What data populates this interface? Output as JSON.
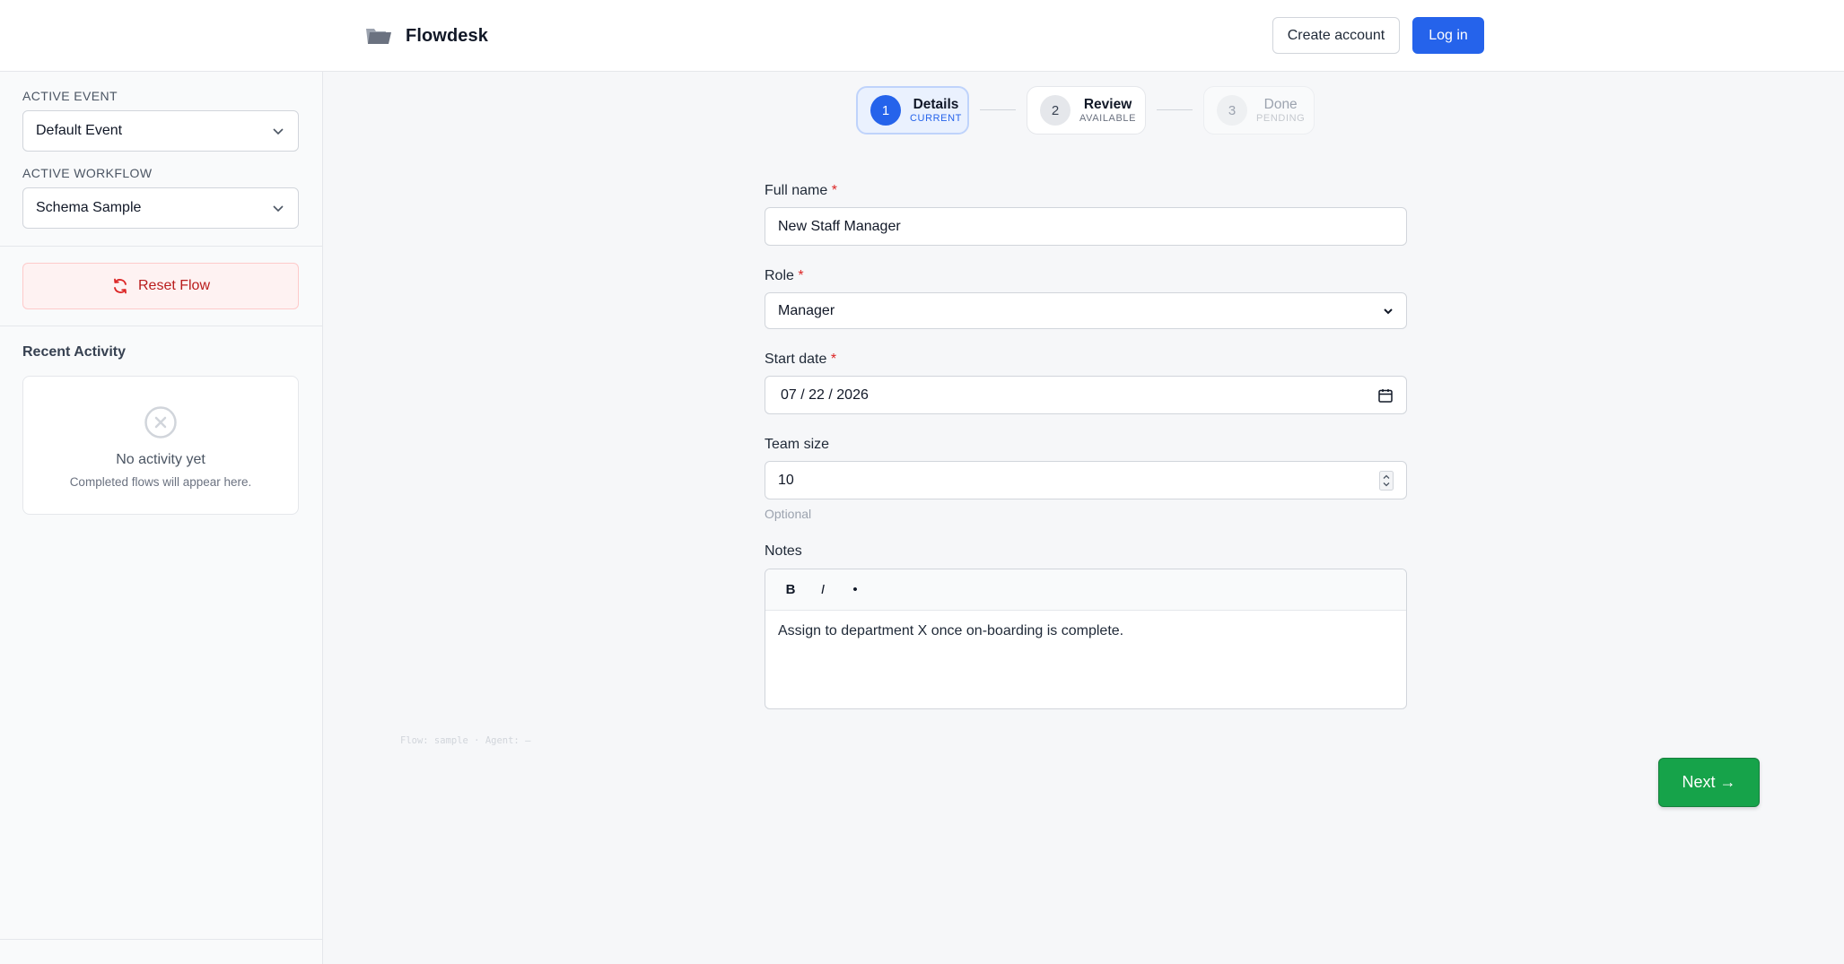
{
  "header": {
    "brand_name": "Flowdesk",
    "create_account_label": "Create account",
    "login_label": "Log in"
  },
  "sidebar": {
    "active_event_label": "ACTIVE EVENT",
    "active_event_value": "Default Event",
    "active_workflow_label": "ACTIVE WORKFLOW",
    "active_workflow_value": "Schema Sample",
    "reset_label": "Reset Flow",
    "recent_title": "Recent Activity",
    "empty_title": "No activity yet",
    "empty_subtitle": "Completed flows will appear here."
  },
  "stepper": {
    "steps": [
      {
        "number": "1",
        "title": "Details",
        "status": "CURRENT"
      },
      {
        "number": "2",
        "title": "Review",
        "status": "AVAILABLE"
      },
      {
        "number": "3",
        "title": "Done",
        "status": "PENDING"
      }
    ]
  },
  "form": {
    "full_name": {
      "label": "Full name",
      "required": "*",
      "value": "New Staff Manager"
    },
    "role": {
      "label": "Role",
      "required": "*",
      "value": "Manager"
    },
    "start_date": {
      "label": "Start date",
      "required": "*",
      "value": "07 / 22 / 2026"
    },
    "team_size": {
      "label": "Team size",
      "value": "10",
      "help": "Optional"
    },
    "notes": {
      "label": "Notes",
      "toolbar": {
        "bold": "B",
        "italic": "I",
        "bullet": "•"
      },
      "value": "Assign to department X once on-boarding is complete."
    }
  },
  "debug_text": "Flow: sample · Agent: —",
  "next_label": "Next →",
  "colors": {
    "primary": "#2563eb",
    "success": "#16a34a",
    "danger": "#b91c1c"
  },
  "icons": {
    "brand": "folder-logo-icon",
    "reset": "refresh-icon",
    "empty": "circle-x-icon",
    "date": "calendar-icon",
    "select": "chevron-down-icon"
  }
}
